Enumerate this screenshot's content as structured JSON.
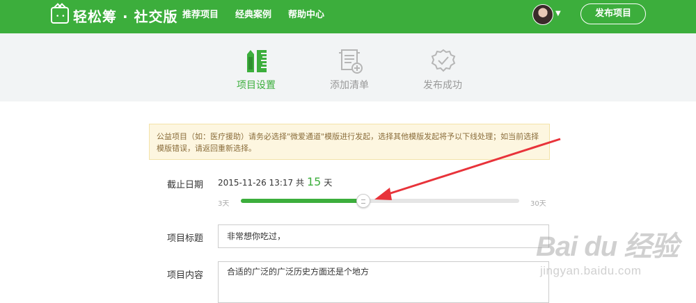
{
  "header": {
    "logo_text": "轻松筹 · 社交版",
    "nav": [
      "推荐项目",
      "经典案例",
      "帮助中心"
    ],
    "publish_label": "发布项目",
    "accent_color": "#3cae3c"
  },
  "steps": [
    {
      "label": "项目设置",
      "icon": "ruler-pencil-icon",
      "active": true
    },
    {
      "label": "添加清单",
      "icon": "list-add-icon",
      "active": false
    },
    {
      "label": "发布成功",
      "icon": "check-circle-icon",
      "active": false
    }
  ],
  "notice": "公益项目（如：医疗援助）请务必选择\"微爱通道\"模版进行发起，选择其他模版发起将予以下线处理；如当前选择模版错误，请返回重新选择。",
  "deadline": {
    "label": "截止日期",
    "date": "2015-11-26 13:17",
    "prefix": "共",
    "days": "15",
    "suffix": "天",
    "min_label": "3天",
    "max_label": "30天",
    "fraction": 0.44
  },
  "title_field": {
    "label": "项目标题",
    "value": "非常想你吃过，"
  },
  "content_field": {
    "label": "项目内容",
    "value": "合适的广泛的广泛历史方面还是个地方"
  },
  "watermark": {
    "main": "Bai du 经验",
    "sub": "jingyan.baidu.com"
  }
}
